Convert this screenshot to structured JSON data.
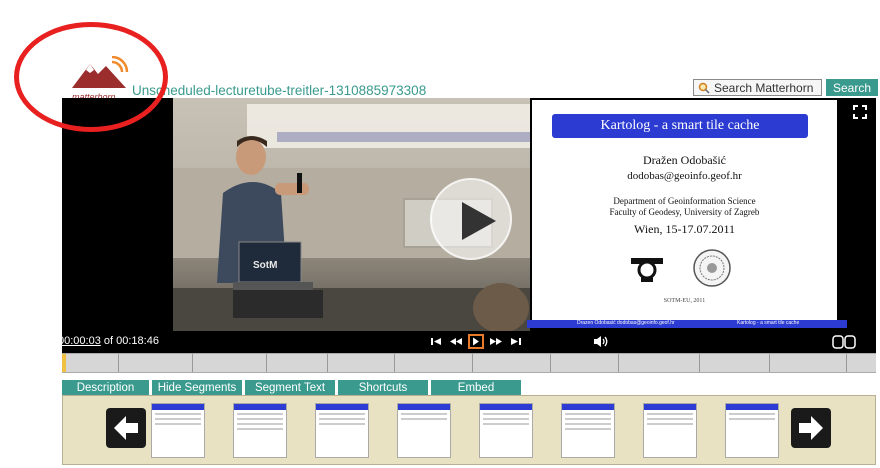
{
  "header": {
    "logo_text": "matterhorn",
    "title": "Unscheduled-lecturetube-treitler-1310885973308",
    "search_placeholder": "Search Matterhorn",
    "search_button": "Search"
  },
  "player": {
    "slide": {
      "title": "Kartolog - a smart tile cache",
      "author": "Dražen Odobašić",
      "email": "dodobas@geoinfo.geof.hr",
      "dept_line1": "Department of Geoinformation Science",
      "dept_line2": "Faculty of Geodesy, University of Zagreb",
      "date": "Wien, 15-17.07.2011",
      "conference": "SOTM-EU, 2011",
      "footer_left": "Drazen Odobasić dodobas@geoinfo.geof.hr",
      "footer_right": "Kartolog - a smart tile cache"
    },
    "current_time": "00:00:03",
    "time_separator": "of",
    "duration": "00:18:46",
    "progress_fraction": 0.003
  },
  "tabs": [
    {
      "label": "Description"
    },
    {
      "label": "Hide Segments"
    },
    {
      "label": "Segment Text"
    },
    {
      "label": "Shortcuts"
    },
    {
      "label": "Embed"
    }
  ],
  "icons": {
    "search": "search-icon",
    "fullscreen": "fullscreen-icon",
    "skip_back": "skip-back-icon",
    "rewind": "rewind-icon",
    "play": "play-icon",
    "fast_forward": "fast-forward-icon",
    "skip_forward": "skip-forward-icon",
    "volume": "volume-icon",
    "captions": "captions-icon",
    "prev": "arrow-left-icon",
    "next": "arrow-right-icon"
  },
  "colors": {
    "accent": "#3a9a8e",
    "slide_blue": "#2c3bd1",
    "annotation": "#e82020",
    "play_highlight": "#e87a2a"
  }
}
